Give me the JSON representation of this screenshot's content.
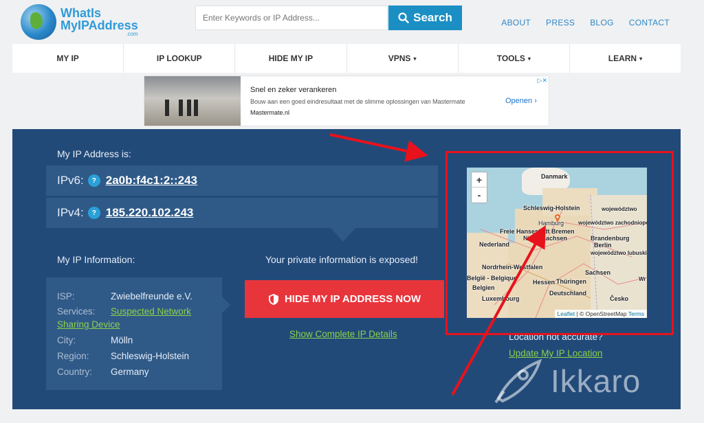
{
  "header": {
    "logo_line1": "WhatIs",
    "logo_line2": "MyIPAddress",
    "logo_sub": ".com",
    "search_placeholder": "Enter Keywords or IP Address...",
    "search_label": "Search",
    "links": [
      "ABOUT",
      "PRESS",
      "BLOG",
      "CONTACT"
    ]
  },
  "nav": {
    "items": [
      {
        "label": "MY IP"
      },
      {
        "label": "IP LOOKUP"
      },
      {
        "label": "HIDE MY IP"
      },
      {
        "label": "VPNS"
      },
      {
        "label": "TOOLS"
      },
      {
        "label": "LEARN"
      }
    ],
    "caret": "▾"
  },
  "ad": {
    "title": "Snel en zeker verankeren",
    "description": "Bouw aan een goed eindresultaat met de slimme oplossingen van Mastermate",
    "url": "Mastermate.nl",
    "cta": "Openen"
  },
  "ip": {
    "heading": "My IP Address is:",
    "ipv6_label": "IPv6:",
    "ipv6_value": "2a0b:f4c1:2::243",
    "ipv4_label": "IPv4:",
    "ipv4_value": "185.220.102.243",
    "help_glyph": "?"
  },
  "info": {
    "heading": "My IP Information:",
    "isp_key": "ISP:",
    "isp_val": "Zwiebelfreunde e.V.",
    "services_key": "Services:",
    "services_val_1": "Suspected Network",
    "services_val_2": "Sharing Device",
    "city_key": "City:",
    "city_val": "Mölln",
    "region_key": "Region:",
    "region_val": "Schleswig-Holstein",
    "country_key": "Country:",
    "country_val": "Germany"
  },
  "action": {
    "exposed_text": "Your private information is exposed!",
    "hide_button": "HIDE MY IP ADDRESS NOW",
    "show_details": "Show Complete IP Details",
    "location_text": "Location not accurate?",
    "update_location": "Update My IP Location"
  },
  "map": {
    "zoom_in": "+",
    "zoom_out": "-",
    "labels": [
      "Danmark",
      "Schleswig-Holstein",
      "Hamburg",
      "Freie Hansestadt Bremen",
      "Niedersachsen",
      "Nederland",
      "Brandenburg",
      "Berlin",
      "Nordrhein-Westfalen",
      "Hessen",
      "Thüringen",
      "België - Belgique",
      "Belgien",
      "Sachsen",
      "Deutschland",
      "Luxembourg",
      "Česko",
      "województwo",
      "województwo zachodniopo",
      "województwo lubuski",
      "Wr"
    ],
    "attribution_leaflet": "Leaflet",
    "attribution_sep": " | © OpenStreetMap ",
    "attribution_terms": "Terms"
  },
  "watermark": {
    "text": "Ikkaro"
  },
  "colors": {
    "panel": "#224a79",
    "accent": "#1b8fc4",
    "hide_button": "#e8353c",
    "link_green": "#8dd14b",
    "annotation": "#e8121c"
  }
}
